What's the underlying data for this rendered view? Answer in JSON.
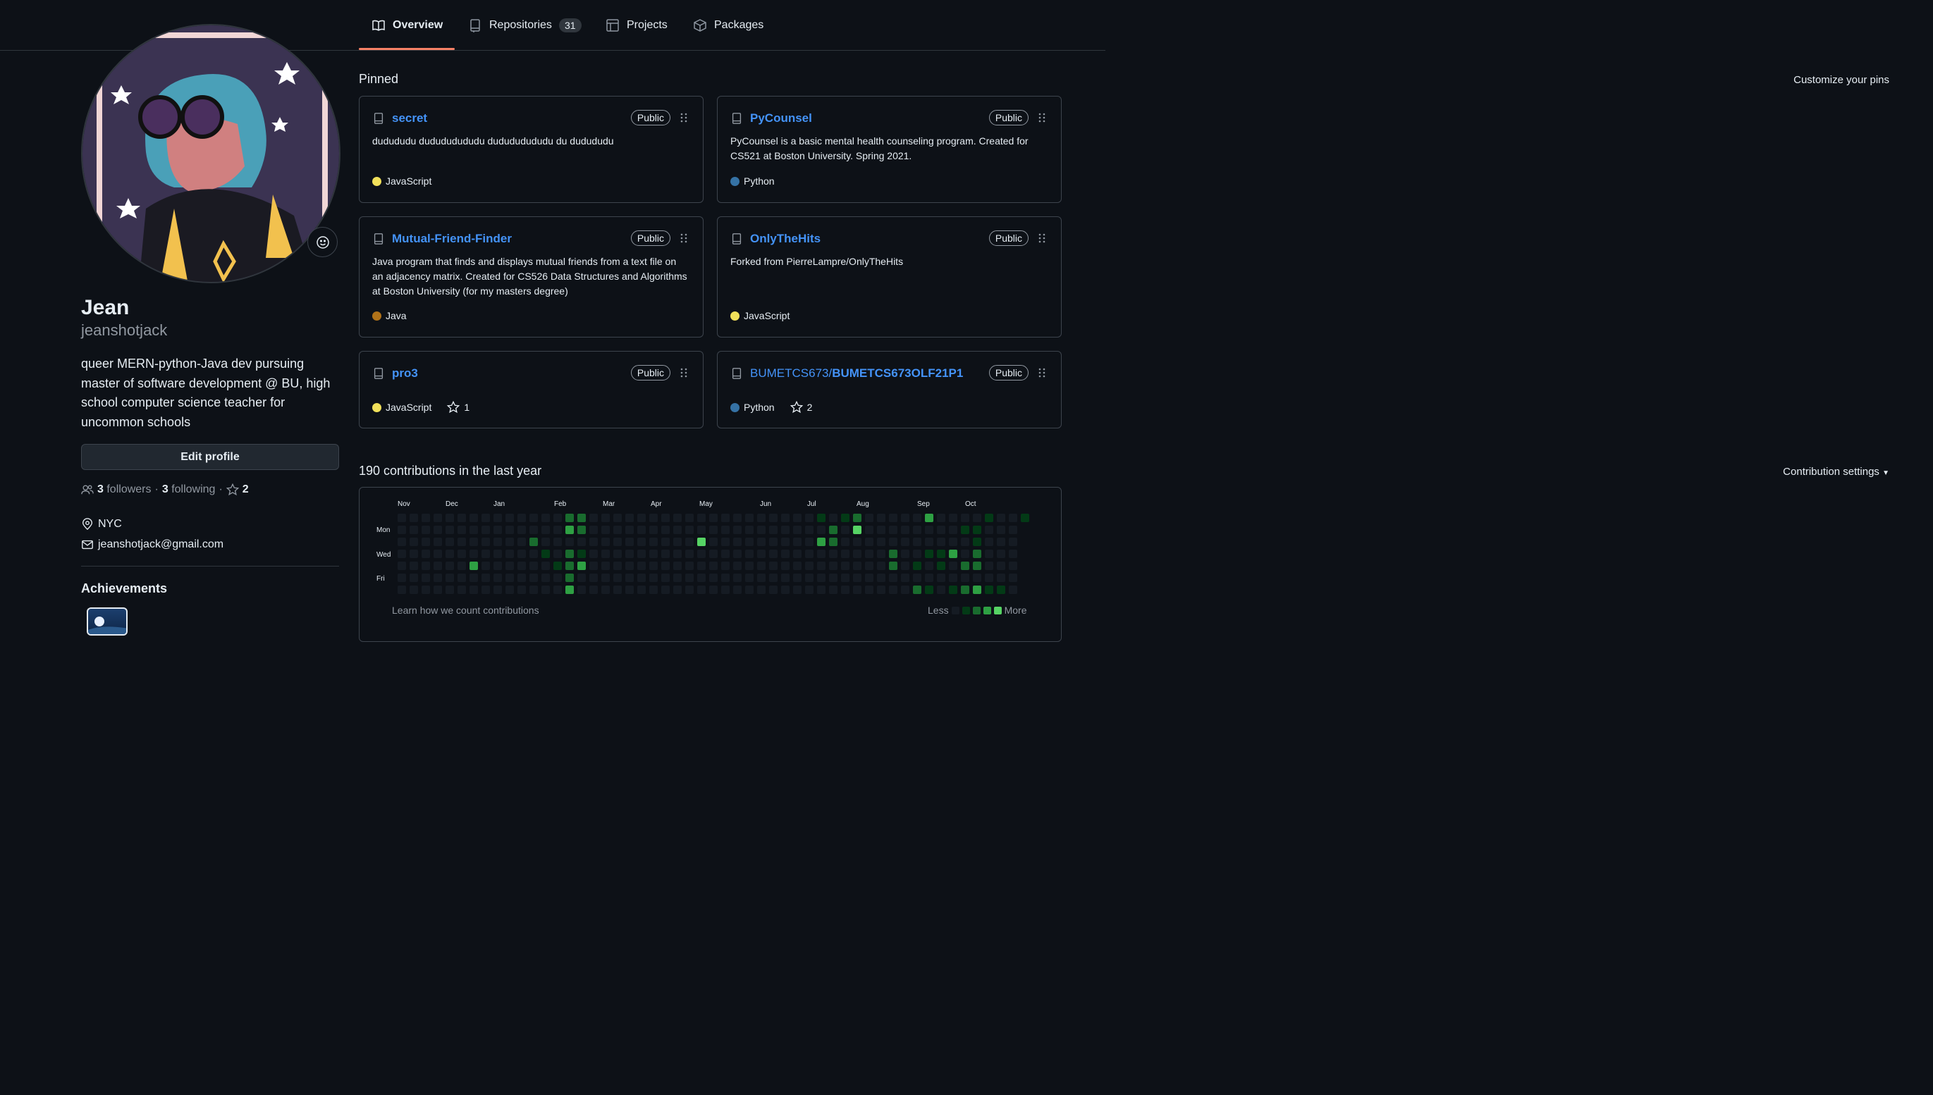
{
  "tabs": [
    {
      "label": "Overview",
      "icon": "book-icon",
      "active": true
    },
    {
      "label": "Repositories",
      "icon": "repo-icon",
      "count": "31"
    },
    {
      "label": "Projects",
      "icon": "table-icon"
    },
    {
      "label": "Packages",
      "icon": "package-icon"
    }
  ],
  "profile": {
    "name": "Jean",
    "username": "jeanshotjack",
    "bio": "queer MERN-python-Java dev pursuing master of software development @ BU, high school computer science teacher for uncommon schools",
    "edit_label": "Edit profile",
    "followers_count": "3",
    "followers_label": "followers",
    "following_count": "3",
    "following_label": "following",
    "stars_count": "2",
    "location": "NYC",
    "email": "jeanshotjack@gmail.com",
    "achievements_title": "Achievements"
  },
  "pinned": {
    "title": "Pinned",
    "customize_label": "Customize your pins",
    "cards": [
      {
        "name": "secret",
        "owner": "",
        "visibility": "Public",
        "description": "dudududu dudududududu dudududududu du dudududu",
        "language": "JavaScript",
        "lang_color": "#f1e05a",
        "stars": ""
      },
      {
        "name": "PyCounsel",
        "owner": "",
        "visibility": "Public",
        "description": "PyCounsel is a basic mental health counseling program. Created for CS521 at Boston University. Spring 2021.",
        "language": "Python",
        "lang_color": "#3572A5",
        "stars": ""
      },
      {
        "name": "Mutual-Friend-Finder",
        "owner": "",
        "visibility": "Public",
        "description": "Java program that finds and displays mutual friends from a text file on an adjacency matrix. Created for CS526 Data Structures and Algorithms at Boston University (for my masters degree)",
        "language": "Java",
        "lang_color": "#b07219",
        "stars": ""
      },
      {
        "name": "OnlyTheHits",
        "owner": "",
        "visibility": "Public",
        "description": "Forked from PierreLampre/OnlyTheHits",
        "language": "JavaScript",
        "lang_color": "#f1e05a",
        "stars": ""
      },
      {
        "name": "pro3",
        "owner": "",
        "visibility": "Public",
        "description": "",
        "language": "JavaScript",
        "lang_color": "#f1e05a",
        "stars": "1"
      },
      {
        "name": "BUMETCS673OLF21P1",
        "owner": "BUMETCS673/",
        "visibility": "Public",
        "description": "",
        "language": "Python",
        "lang_color": "#3572A5",
        "stars": "2"
      }
    ]
  },
  "contributions": {
    "title": "190 contributions in the last year",
    "settings_label": "Contribution settings",
    "months": [
      "Nov",
      "Dec",
      "Jan",
      "Feb",
      "Mar",
      "Apr",
      "May",
      "Jun",
      "Jul",
      "Aug",
      "Sep",
      "Oct"
    ],
    "days": [
      "Mon",
      "Wed",
      "Fri"
    ],
    "learn_label": "Learn how we count contributions",
    "less_label": "Less",
    "more_label": "More",
    "colors": [
      "#151b23",
      "#033a16",
      "#196c2e",
      "#2ea043",
      "#56d364"
    ],
    "grid": [
      "0000000000000000000000000000000000000000000000000000000000000000000000000000000000000",
      "0000000000000030000000000000000000000000000000000000000000000000000000000000000000000",
      "0000000000000000000000000000000000000000000000000000000000000000000000000000000000000"
    ]
  }
}
